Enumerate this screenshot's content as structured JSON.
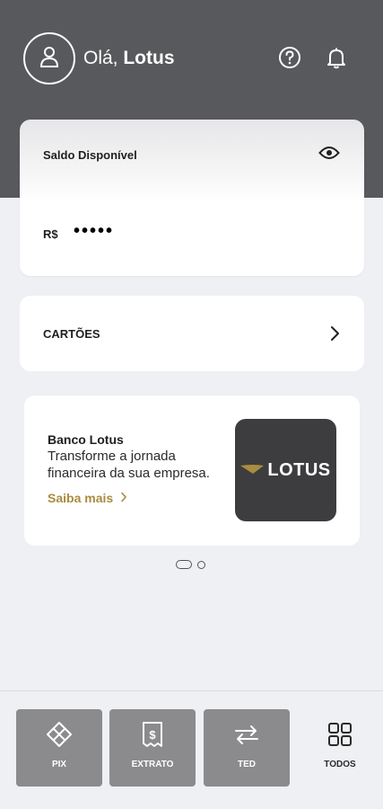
{
  "header": {
    "greeting_prefix": "Olá,",
    "user_name": "Lotus",
    "avatar_icon": "user-icon",
    "help_icon": "help-circle-icon",
    "bell_icon": "bell-icon"
  },
  "balance": {
    "title": "Saldo Disponível",
    "currency": "R$",
    "masked_value": "•••••",
    "toggle_icon": "eye-icon"
  },
  "cards": {
    "label": "CARTÕES",
    "chevron_icon": "chevron-right-icon"
  },
  "promo": {
    "title": "Banco Lotus",
    "description": "Transforme a jornada financeira da sua empresa.",
    "link_label": "Saiba mais",
    "logo_text": "LOTUS",
    "accent_color": "#a98c3f"
  },
  "pager": {
    "total": 2,
    "active_index": 0
  },
  "actions": [
    {
      "label": "PIX",
      "icon": "pix-icon"
    },
    {
      "label": "EXTRATO",
      "icon": "receipt-icon"
    },
    {
      "label": "TED",
      "icon": "transfer-icon"
    },
    {
      "label": "TODOS",
      "icon": "grid-icon"
    }
  ],
  "colors": {
    "header_bg": "#58595c",
    "page_bg": "#eef0f3",
    "action_bg": "#8b8b8d"
  }
}
